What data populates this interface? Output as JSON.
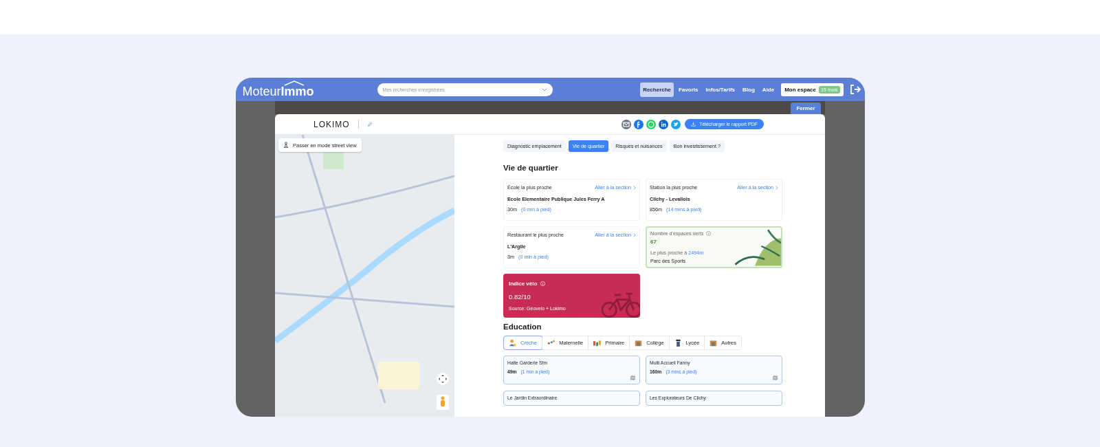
{
  "header": {
    "logo_light": "Moteur",
    "logo_bold": "Immo",
    "search_placeholder": "Mes recherches enregistrées",
    "nav": [
      {
        "label": "Recherche",
        "selected": true
      },
      {
        "label": "Favoris",
        "selected": false
      },
      {
        "label": "Infos/Tarifs",
        "selected": false
      },
      {
        "label": "Blog",
        "selected": false
      },
      {
        "label": "Aide",
        "selected": false
      }
    ],
    "account": {
      "label": "Mon espace",
      "badge": "15 mois"
    }
  },
  "close_button": "Fermer",
  "report": {
    "logo": "LOKIMO",
    "download_button": "Télécharger le rapport PDF",
    "map": {
      "street_view_button": "Passer en mode street view"
    },
    "tabs": [
      {
        "label": "Diagnostic emplacement",
        "selected": false
      },
      {
        "label": "Vie de quartier",
        "selected": true
      },
      {
        "label": "Risques et nuisances",
        "selected": false
      },
      {
        "label": "Bon investissement ?",
        "selected": false
      }
    ],
    "section_title": "Vie de quartier",
    "cards": [
      {
        "kind": "nearest",
        "label": "École la plus proche",
        "link": "Aller à la section",
        "name": "Ecole Elementaire Publique Jules Ferry A",
        "distance": "30m",
        "walk": "(0 min à pied)"
      },
      {
        "kind": "nearest",
        "label": "Station la plus proche",
        "link": "Aller à la section",
        "name": "Clichy - Levallois",
        "distance": "856m",
        "walk": "(14 mins à pied)"
      },
      {
        "kind": "nearest",
        "label": "Restaurant le plus proche",
        "link": "Aller à la section",
        "name": "L'Argile",
        "distance": "3m",
        "walk": "(0 min à pied)"
      },
      {
        "kind": "green",
        "label": "Nombre d'espaces verts",
        "count": "67",
        "nearest_text": "Le plus proche à",
        "nearest_distance": "2494m",
        "name": "Parc des Sports"
      },
      {
        "kind": "bike",
        "title": "Indice vélo",
        "value": "0.82/10",
        "source": "Source: Géovelo + Lokimo"
      }
    ],
    "education": {
      "title": "Education",
      "tabs": [
        {
          "label": "Crèche",
          "selected": true
        },
        {
          "label": "Maternelle",
          "selected": false
        },
        {
          "label": "Primaire",
          "selected": false
        },
        {
          "label": "Collège",
          "selected": false
        },
        {
          "label": "Lycée",
          "selected": false
        },
        {
          "label": "Autres",
          "selected": false
        }
      ],
      "results": [
        {
          "name": "Halte Garderie Sfm",
          "distance": "49m",
          "walk": "(1 min à pied)"
        },
        {
          "name": "Multi Accueil Fanny",
          "distance": "160m",
          "walk": "(3 mins à pied)"
        },
        {
          "name": "Le Jardin Extraordinaire"
        },
        {
          "name": "Les Explorateurs De Clichy"
        }
      ]
    }
  }
}
